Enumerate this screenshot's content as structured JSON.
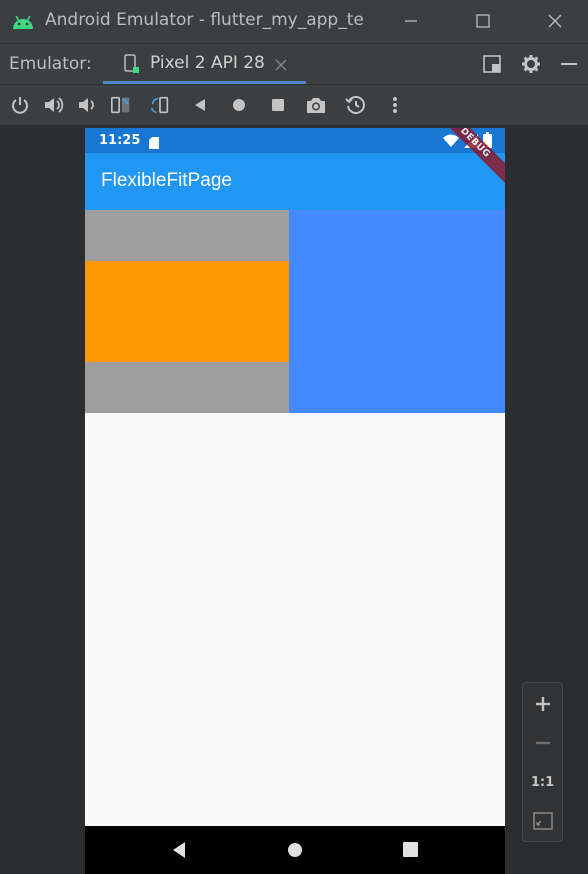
{
  "window": {
    "title": "Android Emulator - flutter_my_app_te"
  },
  "tabbar": {
    "label": "Emulator:",
    "active_tab": "Pixel 2 API 28"
  },
  "toolbar": {
    "icons": [
      "power-icon",
      "volume-up-icon",
      "volume-down-icon",
      "rotate-left-icon",
      "rotate-right-icon",
      "back-icon",
      "home-icon",
      "overview-icon",
      "screenshot-icon",
      "snapshot-icon",
      "more-icon"
    ]
  },
  "device": {
    "status_time": "11:25",
    "app_title": "FlexibleFitPage",
    "debug_banner": "DEBUG"
  },
  "zoom": {
    "ratio_label": "1:1"
  },
  "colors": {
    "status_bar": "#1976d2",
    "app_bar": "#2196f3",
    "grey_box": "#9e9e9e",
    "orange_box": "#ff9800",
    "blue_box": "#448aff",
    "debug_banner": "#8b1a2b"
  }
}
